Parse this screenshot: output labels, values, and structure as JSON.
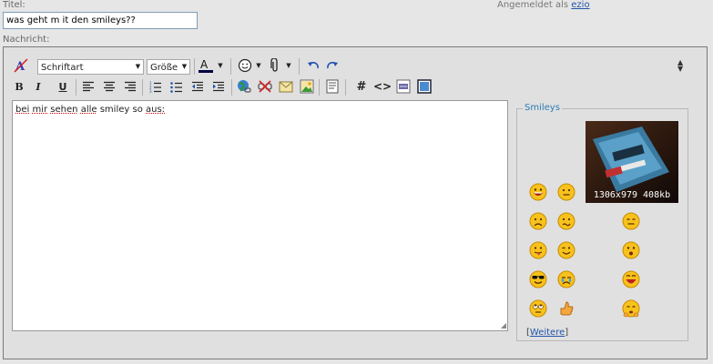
{
  "form": {
    "title_label": "Titel:",
    "title_value": "was geht m it den smileys??",
    "message_label": "Nachricht:"
  },
  "login": {
    "text": "Angemeldet als",
    "user": "ezio"
  },
  "toolbar": {
    "font_select": "Schriftart",
    "size_select": "Größe",
    "bold": "B",
    "italic": "I",
    "underline": "U",
    "hash": "#",
    "code": "<>"
  },
  "editor": {
    "message_words": [
      "bei",
      "mir",
      "sehen",
      "alle",
      "smiley",
      "so",
      "aus:"
    ]
  },
  "smileys": {
    "legend": "Smileys",
    "thumbnail_caption": "1306x979 408kb",
    "more_link": "Weitere",
    "more_open": "[",
    "more_close": "]"
  },
  "colors": {
    "accent": "#2a7db7",
    "link": "#2255aa",
    "smiley_yellow": "#f5c518"
  }
}
